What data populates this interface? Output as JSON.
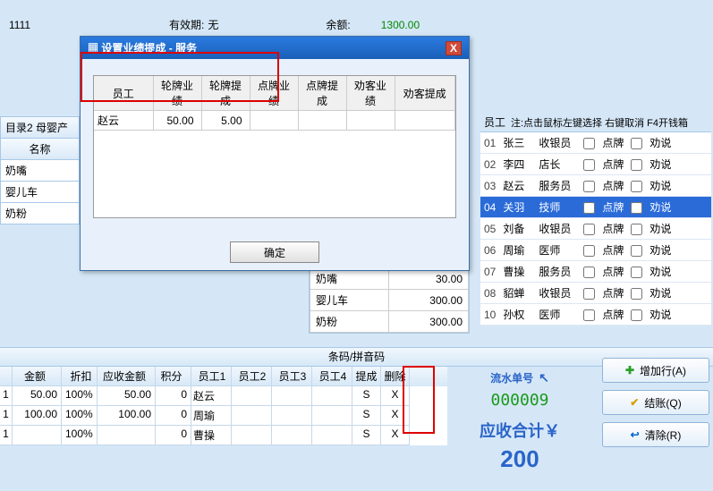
{
  "top": {
    "code": "1111",
    "validity_label": "有效期:",
    "validity_value": "无",
    "balance_label": "余额:",
    "balance_value": "1300.00"
  },
  "dialog": {
    "title": "设置业绩提成 - 服务",
    "columns": {
      "emp": "员工",
      "lp_perf": "轮牌业绩",
      "lp_comm": "轮牌提成",
      "dp_perf": "点牌业绩",
      "dp_comm": "点牌提成",
      "lk_perf": "劝客业绩",
      "lk_comm": "劝客提成"
    },
    "row": {
      "name": "赵云",
      "lp_perf": "50.00",
      "lp_comm": "5.00"
    },
    "ok": "确定"
  },
  "cat": {
    "title": "目录2 母婴产",
    "header": "名称",
    "items": [
      "奶嘴",
      "婴儿车",
      "奶粉"
    ]
  },
  "prod": {
    "rows": [
      {
        "name": "奶嘴",
        "price": "30.00"
      },
      {
        "name": "婴儿车",
        "price": "300.00"
      },
      {
        "name": "奶粉",
        "price": "300.00"
      }
    ]
  },
  "emp": {
    "head_emp": "员工",
    "head_note": "注:点击鼠标左键选择 右键取消 F4开钱箱",
    "btn_dp": "点牌",
    "btn_qs": "劝说",
    "rows": [
      {
        "no": "01",
        "name": "张三",
        "role": "收银员"
      },
      {
        "no": "02",
        "name": "李四",
        "role": "店长"
      },
      {
        "no": "03",
        "name": "赵云",
        "role": "服务员"
      },
      {
        "no": "04",
        "name": "关羽",
        "role": "技师"
      },
      {
        "no": "05",
        "name": "刘备",
        "role": "收银员"
      },
      {
        "no": "06",
        "name": "周瑜",
        "role": "医师"
      },
      {
        "no": "07",
        "name": "曹操",
        "role": "服务员"
      },
      {
        "no": "08",
        "name": "貂蝉",
        "role": "收银员"
      },
      {
        "no": "10",
        "name": "孙权",
        "role": "医师"
      }
    ],
    "selected_index": 3
  },
  "search": {
    "label": "条码/拼音码"
  },
  "cart": {
    "cols": {
      "amount": "金额",
      "disc": "折扣",
      "recv": "应收金额",
      "pts": "积分",
      "e1": "员工1",
      "e2": "员工2",
      "e3": "员工3",
      "e4": "员工4",
      "ti": "提成",
      "del": "删除"
    },
    "rows": [
      {
        "idx": "1",
        "amt": "50.00",
        "disc": "100%",
        "recv": "50.00",
        "pts": "0",
        "e1": "赵云",
        "ti": "S",
        "del": "X"
      },
      {
        "idx": "1",
        "amt": "100.00",
        "disc": "100%",
        "recv": "100.00",
        "pts": "0",
        "e1": "周瑜",
        "ti": "S",
        "del": "X"
      },
      {
        "idx": "1",
        "amt": "",
        "disc": "100%",
        "recv": "",
        "pts": "0",
        "e1": "曹操",
        "ti": "S",
        "del": "X"
      }
    ]
  },
  "summary": {
    "order_label": "流水单号",
    "order_no": "000009",
    "due_label": "应收合计￥",
    "due_value": "200"
  },
  "btns": {
    "add": "增加行(A)",
    "checkout": "结账(Q)",
    "clear": "清除(R)"
  }
}
